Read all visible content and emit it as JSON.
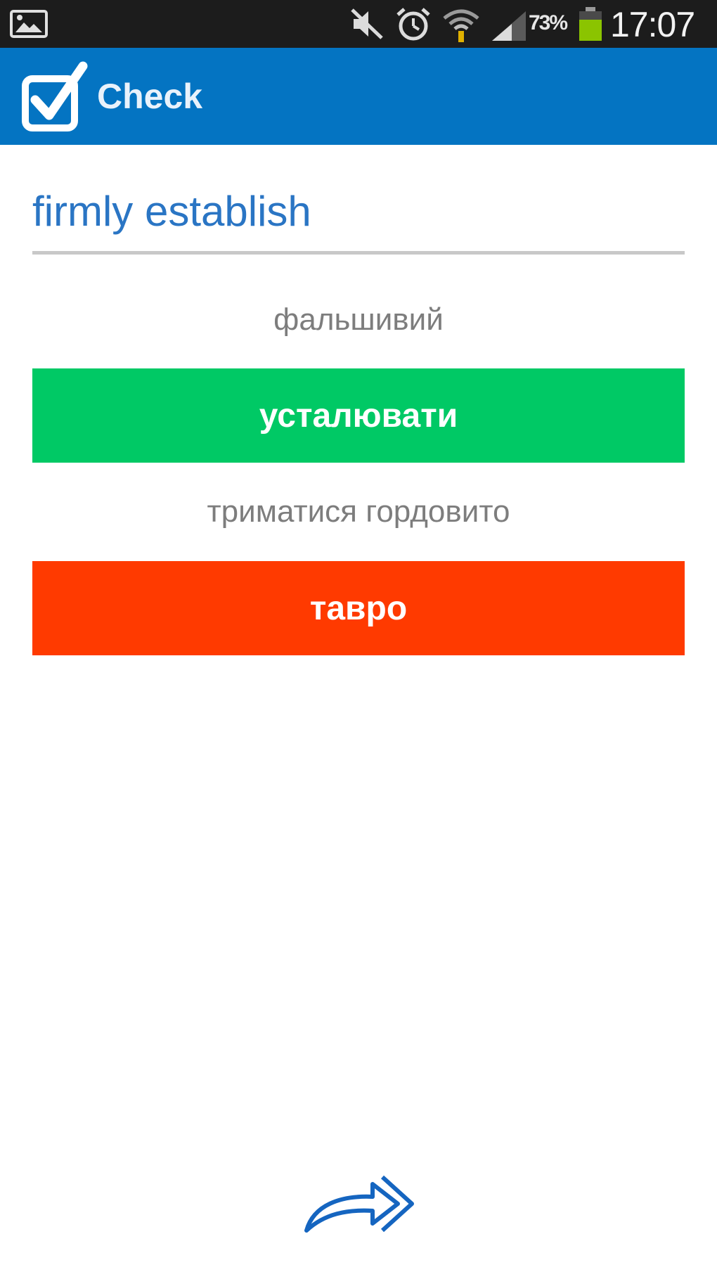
{
  "status_bar": {
    "battery_percent": "73%",
    "time": "17:07",
    "icons": [
      "gallery-icon",
      "mute-icon",
      "alarm-icon",
      "wifi-icon",
      "signal-icon",
      "battery-icon"
    ]
  },
  "action_bar": {
    "title": "Check",
    "logo_icon": "checkbox-icon",
    "color": "#0474c2"
  },
  "quiz": {
    "word": "firmly establish",
    "options": [
      {
        "label": "фальшивий",
        "answer": "усталювати",
        "state": "correct",
        "color": "#00c965"
      },
      {
        "label": "триматися гордовито",
        "answer": "тавро",
        "state": "wrong",
        "color": "#ff3a00"
      }
    ]
  },
  "navigation": {
    "next_icon": "forward-arrow-icon"
  }
}
